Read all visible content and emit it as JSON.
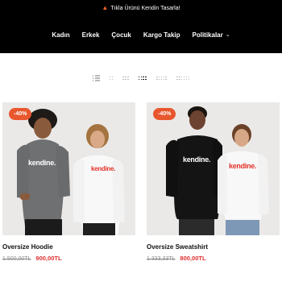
{
  "announcement": {
    "icon": "flame-icon",
    "text": "Tıkla Ürünü Kendin Tasarla!"
  },
  "nav": {
    "items": [
      "Kadın",
      "Erkek",
      "Çocuk",
      "Kargo Takip"
    ],
    "dropdown": "Politikalar"
  },
  "grid_options": [
    "list",
    "2",
    "3",
    "4",
    "5",
    "6"
  ],
  "grid_active": "4",
  "products": [
    {
      "badge": "-40%",
      "title": "Oversize Hoodie",
      "old_price": "1.500,00TL",
      "price": "900,00TL",
      "print_text_dark": "kendine.",
      "print_text_light": "kendine."
    },
    {
      "badge": "-40%",
      "title": "Oversize Sweatshirt",
      "old_price": "1.333,33TL",
      "price": "800,00TL",
      "print_text_dark": "kendine.",
      "print_text_light": "kendine."
    }
  ],
  "colors": {
    "accent": "#e8572e",
    "sale_price": "#e02d2d",
    "header_bg": "#000000"
  }
}
